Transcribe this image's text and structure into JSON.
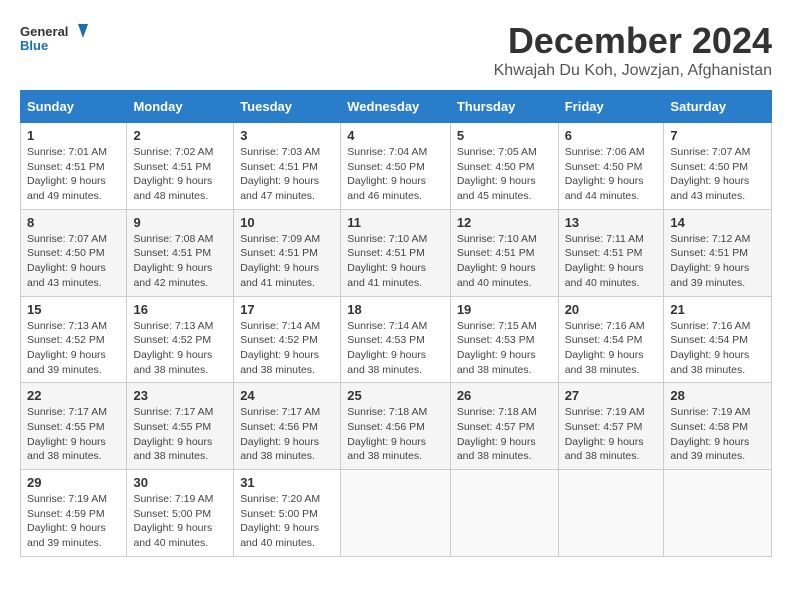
{
  "header": {
    "logo_line1": "General",
    "logo_line2": "Blue",
    "month": "December 2024",
    "location": "Khwajah Du Koh, Jowzjan, Afghanistan"
  },
  "weekdays": [
    "Sunday",
    "Monday",
    "Tuesday",
    "Wednesday",
    "Thursday",
    "Friday",
    "Saturday"
  ],
  "weeks": [
    [
      {
        "day": "1",
        "sunrise": "7:01 AM",
        "sunset": "4:51 PM",
        "daylight": "9 hours and 49 minutes."
      },
      {
        "day": "2",
        "sunrise": "7:02 AM",
        "sunset": "4:51 PM",
        "daylight": "9 hours and 48 minutes."
      },
      {
        "day": "3",
        "sunrise": "7:03 AM",
        "sunset": "4:51 PM",
        "daylight": "9 hours and 47 minutes."
      },
      {
        "day": "4",
        "sunrise": "7:04 AM",
        "sunset": "4:50 PM",
        "daylight": "9 hours and 46 minutes."
      },
      {
        "day": "5",
        "sunrise": "7:05 AM",
        "sunset": "4:50 PM",
        "daylight": "9 hours and 45 minutes."
      },
      {
        "day": "6",
        "sunrise": "7:06 AM",
        "sunset": "4:50 PM",
        "daylight": "9 hours and 44 minutes."
      },
      {
        "day": "7",
        "sunrise": "7:07 AM",
        "sunset": "4:50 PM",
        "daylight": "9 hours and 43 minutes."
      }
    ],
    [
      {
        "day": "8",
        "sunrise": "7:07 AM",
        "sunset": "4:50 PM",
        "daylight": "9 hours and 43 minutes."
      },
      {
        "day": "9",
        "sunrise": "7:08 AM",
        "sunset": "4:51 PM",
        "daylight": "9 hours and 42 minutes."
      },
      {
        "day": "10",
        "sunrise": "7:09 AM",
        "sunset": "4:51 PM",
        "daylight": "9 hours and 41 minutes."
      },
      {
        "day": "11",
        "sunrise": "7:10 AM",
        "sunset": "4:51 PM",
        "daylight": "9 hours and 41 minutes."
      },
      {
        "day": "12",
        "sunrise": "7:10 AM",
        "sunset": "4:51 PM",
        "daylight": "9 hours and 40 minutes."
      },
      {
        "day": "13",
        "sunrise": "7:11 AM",
        "sunset": "4:51 PM",
        "daylight": "9 hours and 40 minutes."
      },
      {
        "day": "14",
        "sunrise": "7:12 AM",
        "sunset": "4:51 PM",
        "daylight": "9 hours and 39 minutes."
      }
    ],
    [
      {
        "day": "15",
        "sunrise": "7:13 AM",
        "sunset": "4:52 PM",
        "daylight": "9 hours and 39 minutes."
      },
      {
        "day": "16",
        "sunrise": "7:13 AM",
        "sunset": "4:52 PM",
        "daylight": "9 hours and 38 minutes."
      },
      {
        "day": "17",
        "sunrise": "7:14 AM",
        "sunset": "4:52 PM",
        "daylight": "9 hours and 38 minutes."
      },
      {
        "day": "18",
        "sunrise": "7:14 AM",
        "sunset": "4:53 PM",
        "daylight": "9 hours and 38 minutes."
      },
      {
        "day": "19",
        "sunrise": "7:15 AM",
        "sunset": "4:53 PM",
        "daylight": "9 hours and 38 minutes."
      },
      {
        "day": "20",
        "sunrise": "7:16 AM",
        "sunset": "4:54 PM",
        "daylight": "9 hours and 38 minutes."
      },
      {
        "day": "21",
        "sunrise": "7:16 AM",
        "sunset": "4:54 PM",
        "daylight": "9 hours and 38 minutes."
      }
    ],
    [
      {
        "day": "22",
        "sunrise": "7:17 AM",
        "sunset": "4:55 PM",
        "daylight": "9 hours and 38 minutes."
      },
      {
        "day": "23",
        "sunrise": "7:17 AM",
        "sunset": "4:55 PM",
        "daylight": "9 hours and 38 minutes."
      },
      {
        "day": "24",
        "sunrise": "7:17 AM",
        "sunset": "4:56 PM",
        "daylight": "9 hours and 38 minutes."
      },
      {
        "day": "25",
        "sunrise": "7:18 AM",
        "sunset": "4:56 PM",
        "daylight": "9 hours and 38 minutes."
      },
      {
        "day": "26",
        "sunrise": "7:18 AM",
        "sunset": "4:57 PM",
        "daylight": "9 hours and 38 minutes."
      },
      {
        "day": "27",
        "sunrise": "7:19 AM",
        "sunset": "4:57 PM",
        "daylight": "9 hours and 38 minutes."
      },
      {
        "day": "28",
        "sunrise": "7:19 AM",
        "sunset": "4:58 PM",
        "daylight": "9 hours and 39 minutes."
      }
    ],
    [
      {
        "day": "29",
        "sunrise": "7:19 AM",
        "sunset": "4:59 PM",
        "daylight": "9 hours and 39 minutes."
      },
      {
        "day": "30",
        "sunrise": "7:19 AM",
        "sunset": "5:00 PM",
        "daylight": "9 hours and 40 minutes."
      },
      {
        "day": "31",
        "sunrise": "7:20 AM",
        "sunset": "5:00 PM",
        "daylight": "9 hours and 40 minutes."
      },
      null,
      null,
      null,
      null
    ]
  ]
}
